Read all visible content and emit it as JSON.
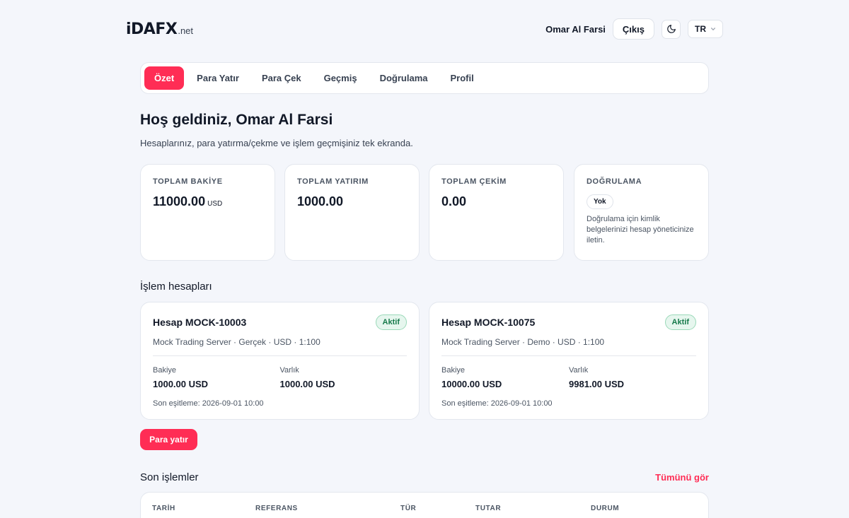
{
  "header": {
    "logo_main": "iDAFX",
    "logo_tld": ".net",
    "user_name": "Omar Al Farsi",
    "logout_label": "Çıkış",
    "theme_icon": "moon-icon",
    "lang": "TR"
  },
  "nav": {
    "tabs": [
      {
        "label": "Özet",
        "active": true
      },
      {
        "label": "Para Yatır",
        "active": false
      },
      {
        "label": "Para Çek",
        "active": false
      },
      {
        "label": "Geçmiş",
        "active": false
      },
      {
        "label": "Doğrulama",
        "active": false
      },
      {
        "label": "Profil",
        "active": false
      }
    ]
  },
  "welcome": {
    "title": "Hoş geldiniz, Omar Al Farsi",
    "subtitle": "Hesaplarınız, para yatırma/çekme ve işlem geçmişiniz tek ekranda."
  },
  "stats": {
    "balance": {
      "label": "TOPLAM BAKİYE",
      "value": "11000.00",
      "unit": "USD"
    },
    "deposit": {
      "label": "TOPLAM YATIRIM",
      "value": "1000.00"
    },
    "withdraw": {
      "label": "TOPLAM ÇEKİM",
      "value": "0.00"
    },
    "verify": {
      "label": "DOĞRULAMA",
      "status": "Yok",
      "note": "Doğrulama için kimlik belgelerinizi hesap yöneticinize iletin."
    }
  },
  "accounts": {
    "title": "İşlem hesapları",
    "items": [
      {
        "name": "Hesap MOCK-10003",
        "status": "Aktif",
        "meta": "Mock Trading Server · Gerçek · USD · 1:100",
        "balance_label": "Bakiye",
        "balance": "1000.00 USD",
        "equity_label": "Varlık",
        "equity": "1000.00 USD",
        "sync": "Son eşitleme: 2026-09-01 10:00"
      },
      {
        "name": "Hesap MOCK-10075",
        "status": "Aktif",
        "meta": "Mock Trading Server · Demo · USD · 1:100",
        "balance_label": "Bakiye",
        "balance": "10000.00 USD",
        "equity_label": "Varlık",
        "equity": "9981.00 USD",
        "sync": "Son eşitleme: 2026-09-01 10:00"
      }
    ],
    "deposit_button": "Para yatır"
  },
  "transactions": {
    "title": "Son işlemler",
    "see_all": "Tümünü gör",
    "columns": [
      "TARİH",
      "REFERANS",
      "TÜR",
      "TUTAR",
      "DURUM"
    ]
  },
  "colors": {
    "accent": "#ff2d55",
    "background": "#f4f6fb",
    "success": "#177a4b"
  }
}
